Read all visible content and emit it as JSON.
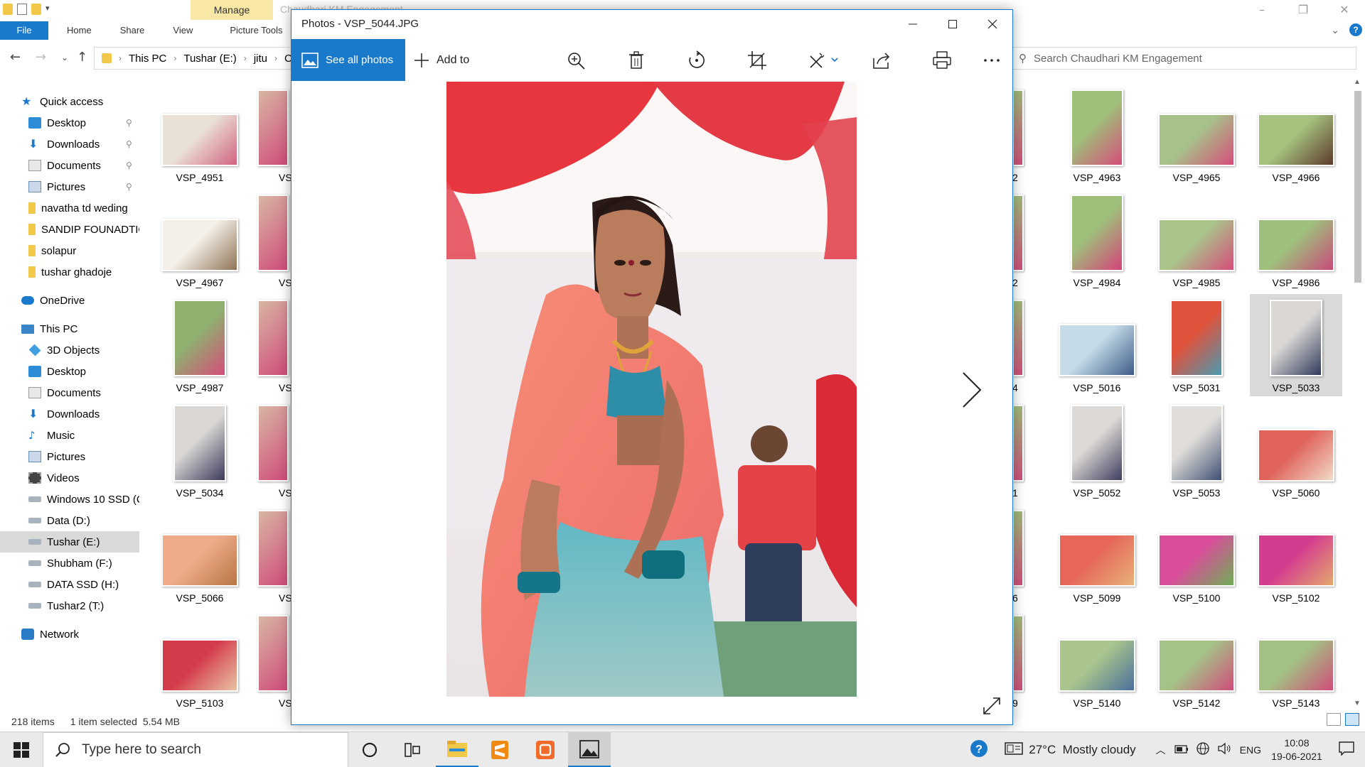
{
  "explorer": {
    "title": "Chaudhari KM Engagement",
    "manage_tab": "Manage",
    "ribbon_tabs": [
      "File",
      "Home",
      "Share",
      "View",
      "Picture Tools"
    ],
    "breadcrumb": [
      "This PC",
      "Tushar (E:)",
      "jitu",
      "C"
    ],
    "search_placeholder": "Search Chaudhari KM Engagement",
    "nav": {
      "quick_access": "Quick access",
      "quick_items": [
        "Desktop",
        "Downloads",
        "Documents",
        "Pictures",
        "navatha td weding",
        "SANDIP FOUNADTIO",
        "solapur",
        "tushar ghadoje"
      ],
      "onedrive": "OneDrive",
      "this_pc": "This PC",
      "pc_items": [
        "3D Objects",
        "Desktop",
        "Documents",
        "Downloads",
        "Music",
        "Pictures",
        "Videos",
        "Windows 10 SSD (C",
        "Data (D:)",
        "Tushar (E:)",
        "Shubham (F:)",
        "DATA SSD (H:)",
        "Tushar2 (T:)"
      ],
      "network": "Network"
    },
    "files_left": [
      {
        "name": "VSP_4951",
        "orient": "land",
        "c1": "#e9e1d6",
        "c2": "#d2627e"
      },
      {
        "name": "VSP_4967",
        "orient": "land",
        "c1": "#f4efe8",
        "c2": "#8e7355"
      },
      {
        "name": "VSP_4987",
        "orient": "port",
        "c1": "#8fb06f",
        "c2": "#d54d7a"
      },
      {
        "name": "VSP_5034",
        "orient": "port",
        "c1": "#d9d6d4",
        "c2": "#3b3a5a"
      },
      {
        "name": "VSP_5066",
        "orient": "land",
        "c1": "#f0ab8a",
        "c2": "#b87544"
      },
      {
        "name": "VSP_5103",
        "orient": "land",
        "c1": "#d43b4a",
        "c2": "#e7c2a3"
      }
    ],
    "files_col2": [
      "VS",
      "VS",
      "VS",
      "VS",
      "VS",
      "VS"
    ],
    "files_right_edge": [
      "",
      "2",
      "2",
      "4",
      "1",
      "6",
      "9"
    ],
    "files_right": [
      [
        {
          "name": "VSP_4963",
          "orient": "port",
          "c1": "#9ec07a",
          "c2": "#d54d7a"
        },
        {
          "name": "VSP_4965",
          "orient": "land",
          "c1": "#a7c38a",
          "c2": "#d54d7a"
        },
        {
          "name": "VSP_4966",
          "orient": "land",
          "c1": "#a5c27e",
          "c2": "#5d3a2c"
        }
      ],
      [
        {
          "name": "VSP_4984",
          "orient": "port",
          "c1": "#9ebf7a",
          "c2": "#d5437a"
        },
        {
          "name": "VSP_4985",
          "orient": "land",
          "c1": "#a9c58a",
          "c2": "#d54d7a"
        },
        {
          "name": "VSP_4986",
          "orient": "land",
          "c1": "#9fc07d",
          "c2": "#c84a7a"
        }
      ],
      [
        {
          "name": "VSP_5016",
          "orient": "land",
          "c1": "#c5dbe8",
          "c2": "#3c5b88"
        },
        {
          "name": "VSP_5031",
          "orient": "port",
          "c1": "#e1523d",
          "c2": "#4a9ab0"
        },
        {
          "name": "VSP_5033",
          "orient": "port",
          "c1": "#d9d6d4",
          "c2": "#2f3a5a",
          "selected": true
        }
      ],
      [
        {
          "name": "VSP_5052",
          "orient": "port",
          "c1": "#dcd8d5",
          "c2": "#3f3e5e"
        },
        {
          "name": "VSP_5053",
          "orient": "port",
          "c1": "#dfdcd9",
          "c2": "#3e4f73"
        },
        {
          "name": "VSP_5060",
          "orient": "land",
          "c1": "#e0645c",
          "c2": "#f1dbc8"
        }
      ],
      [
        {
          "name": "VSP_5099",
          "orient": "land",
          "c1": "#e6675a",
          "c2": "#e8b27a"
        },
        {
          "name": "VSP_5100",
          "orient": "land",
          "c1": "#d94d9b",
          "c2": "#6fae55"
        },
        {
          "name": "VSP_5102",
          "orient": "land",
          "c1": "#d43c8f",
          "c2": "#e3a96c"
        }
      ],
      [
        {
          "name": "VSP_5140",
          "orient": "land",
          "c1": "#a9c58d",
          "c2": "#4b6f9c"
        },
        {
          "name": "VSP_5142",
          "orient": "land",
          "c1": "#a5c386",
          "c2": "#cf4c7a"
        },
        {
          "name": "VSP_5143",
          "orient": "land",
          "c1": "#a3c183",
          "c2": "#cf4c7a"
        }
      ]
    ],
    "status": {
      "count": "218 items",
      "selected": "1 item selected",
      "size": "5.54 MB"
    }
  },
  "photos": {
    "title": "Photos - VSP_5044.JPG",
    "see_all": "See all photos",
    "add_to": "Add to",
    "toolbar_icons": [
      "zoom-icon",
      "delete-icon",
      "rotate-icon",
      "crop-icon",
      "edit-icon",
      "share-icon",
      "print-icon",
      "more-icon"
    ]
  },
  "taskbar": {
    "search_placeholder": "Type here to search",
    "weather": "27°C  Mostly cloudy",
    "lang": "ENG",
    "time": "10:08",
    "date": "19-06-2021"
  },
  "colors": {
    "accent": "#1979ca",
    "selection": "#d9d9d9"
  }
}
